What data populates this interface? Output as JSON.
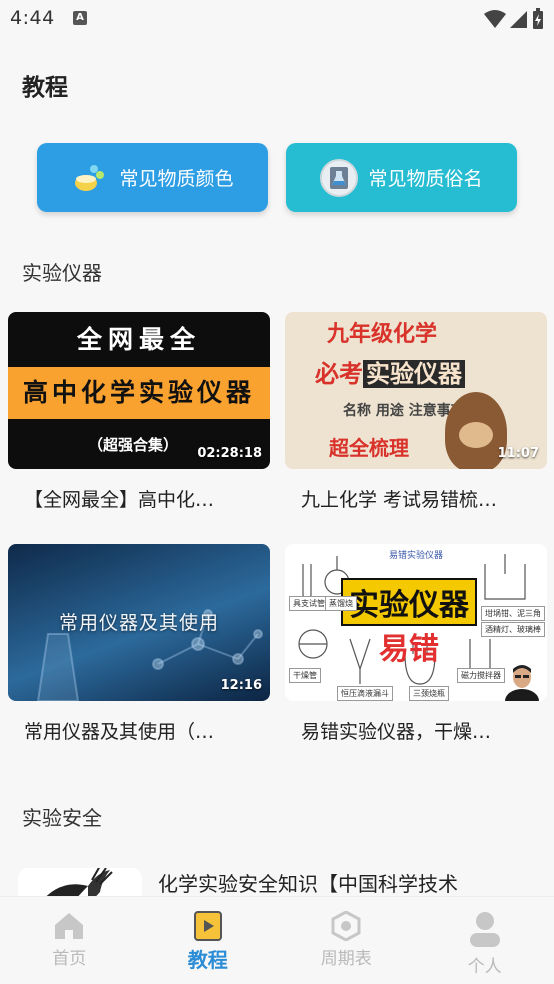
{
  "status_bar": {
    "time": "4:44",
    "notification_glyph": "A"
  },
  "page": {
    "title": "教程"
  },
  "quick_buttons": [
    {
      "label": "常见物质颜色",
      "color": "#2e9ee4",
      "icon": "flask-icon"
    },
    {
      "label": "常见物质俗名",
      "color": "#26bcd1",
      "icon": "book-flask-icon"
    }
  ],
  "sections": {
    "instruments": "实验仪器",
    "safety": "实验安全"
  },
  "videos": [
    {
      "title": "【全网最全】高中化…",
      "duration": "02:28:18",
      "thumb": {
        "line1": "全网最全",
        "line2": "高中化学实验仪器",
        "line3": "（超强合集）"
      }
    },
    {
      "title": "九上化学 考试易错梳…",
      "duration": "11:07",
      "thumb": {
        "line1": "九年级化学",
        "line2a": "必考",
        "line2b": "实验仪器",
        "line3": "名称 用途 注意事项",
        "line4": "超全梳理"
      }
    },
    {
      "title": "常用仪器及其使用（…",
      "duration": "12:16",
      "thumb": {
        "line1": "常用仪器及其使用"
      }
    },
    {
      "title": "易错实验仪器，干燥…",
      "duration": "",
      "thumb": {
        "header": "易错实验仪器",
        "big1": "实验仪器",
        "big2": "易错",
        "tags": [
          "具支试管",
          "蒸馏烧",
          "干燥管",
          "恒压滴液漏斗",
          "三颈烧瓶",
          "磁力搅拌器",
          "坩埚钳、泥三角",
          "酒精灯、玻璃棒"
        ]
      }
    }
  ],
  "safety_item": {
    "title": "化学实验安全知识【中国科学技术"
  },
  "bottom_nav": [
    {
      "label": "首页",
      "icon": "home-icon"
    },
    {
      "label": "教程",
      "icon": "tutorial-icon"
    },
    {
      "label": "周期表",
      "icon": "periodic-table-icon"
    },
    {
      "label": "个人",
      "icon": "person-icon"
    }
  ],
  "colors": {
    "accent": "#2c8dd6",
    "inactive": "#b9b9b9",
    "background": "#f7f7f7"
  }
}
